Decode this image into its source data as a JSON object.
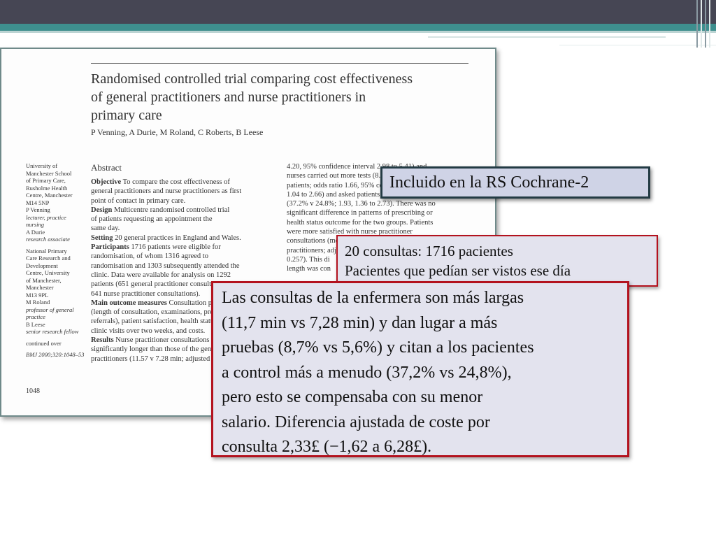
{
  "paper": {
    "title_lines": [
      "Randomised controlled trial comparing cost effectiveness",
      "of general practitioners and nurse practitioners in",
      "primary care"
    ],
    "authors": "P Venning, A Durie, M Roland, C Roberts, B Leese",
    "affiliations": {
      "a1": "University of",
      "a2": "Manchester School",
      "a3": "of Primary Care,",
      "a4": "Rusholme Health",
      "a5": "Centre, Manchester",
      "a6": "M14 5NP",
      "a7": "P Venning",
      "a8": "lecturer, practice",
      "a9": "nursing",
      "a10": "A Durie",
      "a11": "research associate",
      "a12": "National Primary",
      "a13": "Care Research and",
      "a14": "Development",
      "a15": "Centre, University",
      "a16": "of Manchester,",
      "a17": "Manchester",
      "a18": "M13 9PL",
      "a19": "M Roland",
      "a20": "professor of general",
      "a21": "practice",
      "a22": "B Leese",
      "a23": "senior research fellow",
      "a24": "continued over",
      "a25": "BMJ 2000;320:1048–53"
    },
    "abstract_heading": "Abstract",
    "col1": {
      "objective_label": "Objective",
      "objective_l1": " To compare the cost effectiveness of",
      "objective_l2": "general practitioners and nurse practitioners as first",
      "objective_l3": "point of contact in primary care.",
      "design_label": "Design",
      "design_l1": " Multicentre randomised controlled trial",
      "design_l2": "of patients requesting an appointment the",
      "design_l3": "same day.",
      "setting_label": "Setting",
      "setting_l1": " 20 general practices in England and Wales.",
      "participants_label": "Participants",
      "participants_l1": " 1716 patients were eligible for",
      "participants_l2": "randomisation, of whom 1316 agreed to",
      "participants_l3": "randomisation and 1303 subsequently attended the",
      "participants_l4": "clinic. Data were available for analysis on 1292",
      "participants_l5": "patients (651 general practitioner consultations and",
      "participants_l6": "641 nurse practitioner consultations).",
      "outcome_label": "Main outcome measures",
      "outcome_l1": " Consultation process",
      "outcome_l2": "(length of consultation, examinations, prescriptions,",
      "outcome_l3": "referrals), patient satisfaction, health status,",
      "outcome_l4": "clinic visits over two weeks, and costs.",
      "results_label": "Results",
      "results_l1": " Nurse practitioner consultations were",
      "results_l2": "significantly longer than those of the general",
      "results_l3": "practitioners (11.57 v 7.28 min; adjusted"
    },
    "col2": {
      "l1": "4.20, 95% confidence interval 2.98 to 5.41) and",
      "l2": "nurses carried out more tests (8.7% v 5.6% of",
      "l3": "patients; odds ratio 1.66, 95% confidence interval",
      "l4": "1.04 to 2.66) and asked patients to return more often",
      "l5": "(37.2% v 24.8%; 1.93, 1.36 to 2.73). There was no",
      "l6": "significant difference in patterns of prescribing or",
      "l7": "health status outcome for the two groups. Patients",
      "l8": "were more satisfied with nurse practitioner",
      "l9": "consultations (mean difference in score compared with",
      "l10": "practitioners; adjusted",
      "l11": "0.257). This di",
      "l12": "length was con"
    },
    "page_number": "1048"
  },
  "callouts": {
    "blue": "Incluido en la RS Cochrane-2",
    "red1_l1": "20 consultas: 1716 pacientes",
    "red1_l2": "Pacientes que pedían ser vistos ese día",
    "red2_l1": "Las consultas de la enfermera son más largas",
    "red2_l2": "(11,7 min vs 7,28 min) y dan lugar a más",
    "red2_l3": "pruebas (8,7% vs 5,6%) y citan a los pacientes",
    "red2_l4": "a control más a menudo (37,2% vs 24,8%),",
    "red2_l5": "pero esto se compensaba con su menor",
    "red2_l6": "salario. Diferencia ajustada de coste por",
    "red2_l7": "consulta 2,33£ (−1,62 a 6,28£)."
  },
  "colors": {
    "top_bar": "#464654",
    "teal_band": "#3e8f8e",
    "callout_border_red": "#b3121e",
    "callout_border_dark": "#233b44",
    "callout_fill": "#cfd3e6"
  }
}
